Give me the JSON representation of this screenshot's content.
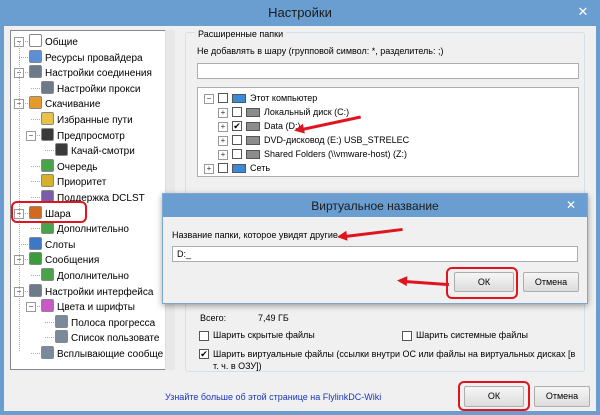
{
  "window": {
    "title": "Настройки",
    "close_glyph": "✕"
  },
  "tree": {
    "items": [
      {
        "label": "Общие",
        "icon": "page-icon",
        "color": "#ffffff",
        "depth": 0
      },
      {
        "label": "Ресурсы провайдера",
        "icon": "users-icon",
        "color": "#5b8fd6",
        "depth": 0
      },
      {
        "label": "Настройки соединения",
        "icon": "network-icon",
        "color": "#6c7a89",
        "depth": 0
      },
      {
        "label": "Настройки прокси",
        "icon": "network-icon",
        "color": "#6c7a89",
        "depth": 1
      },
      {
        "label": "Скачивание",
        "icon": "download-icon",
        "color": "#e39b2b",
        "depth": 0
      },
      {
        "label": "Избранные пути",
        "icon": "folder-icon",
        "color": "#e7c14a",
        "depth": 1
      },
      {
        "label": "Предпросмотр",
        "icon": "film-icon",
        "color": "#3a3a3a",
        "depth": 1
      },
      {
        "label": "Качай-смотри",
        "icon": "film-icon",
        "color": "#3a3a3a",
        "depth": 2
      },
      {
        "label": "Очередь",
        "icon": "queue-icon",
        "color": "#4aa34a",
        "depth": 1
      },
      {
        "label": "Приоритет",
        "icon": "priority-icon",
        "color": "#d6b02b",
        "depth": 1
      },
      {
        "label": "Поддержка DCLST",
        "icon": "dclst-icon",
        "color": "#7a5ca8",
        "depth": 1
      },
      {
        "label": "Шара",
        "icon": "share-icon",
        "color": "#d2691e",
        "depth": 0
      },
      {
        "label": "Дополнительно",
        "icon": "page-icon",
        "color": "#4aa34a",
        "depth": 1
      },
      {
        "label": "Слоты",
        "icon": "slots-icon",
        "color": "#3c78c8",
        "depth": 0
      },
      {
        "label": "Сообщения",
        "icon": "messages-icon",
        "color": "#3c9c3c",
        "depth": 0
      },
      {
        "label": "Дополнительно",
        "icon": "page-icon",
        "color": "#4aa34a",
        "depth": 1
      },
      {
        "label": "Настройки интерфейса",
        "icon": "monitor-icon",
        "color": "#6c7a89",
        "depth": 0
      },
      {
        "label": "Цвета и шрифты",
        "icon": "palette-icon",
        "color": "#c85ac8",
        "depth": 1
      },
      {
        "label": "Полоса прогресса",
        "icon": "progress-icon",
        "color": "#7a8a9a",
        "depth": 2
      },
      {
        "label": "Список пользовате",
        "icon": "list-icon",
        "color": "#7a8a9a",
        "depth": 2
      },
      {
        "label": "Всплывающие сообще",
        "icon": "popup-icon",
        "color": "#7a8a9a",
        "depth": 1
      }
    ]
  },
  "shared": {
    "group_title": "Расширенные папки",
    "hint": "Не добавлять в шару (групповой символ: *, разделитель: ;)",
    "mask_value": "",
    "folders": [
      {
        "label": "Этот компьютер",
        "checked": false,
        "icon": "computer-icon",
        "level": 0,
        "expander": "−"
      },
      {
        "label": "Локальный диск (C:)",
        "checked": false,
        "icon": "drive-icon",
        "level": 1,
        "expander": "+"
      },
      {
        "label": "Data (D:)",
        "checked": true,
        "icon": "drive-icon",
        "level": 1,
        "expander": "+"
      },
      {
        "label": "DVD-дисковод (E:) USB_STRELEC",
        "checked": false,
        "icon": "dvd-drive-icon",
        "level": 1,
        "expander": "+"
      },
      {
        "label": "Shared Folders (\\\\vmware-host) (Z:)",
        "checked": false,
        "icon": "network-drive-icon",
        "level": 1,
        "expander": "+"
      },
      {
        "label": "Сеть",
        "checked": false,
        "icon": "network-icon",
        "level": 0,
        "expander": "+"
      }
    ],
    "total_label": "Всего:",
    "total_value": "7,49 ГБ",
    "options": [
      {
        "label": "Шарить скрытые файлы",
        "checked": false
      },
      {
        "label": "Шарить системные файлы",
        "checked": false
      },
      {
        "label": "Шарить виртуальные файлы (ссылки внутри ОС или файлы на виртуальных дисках [в т. ч. в ОЗУ])",
        "checked": true
      }
    ]
  },
  "dialog": {
    "title": "Виртуальное название",
    "close_glyph": "✕",
    "label": "Название папки, которое увидят другие",
    "value": "D:_",
    "ok": "ОК",
    "cancel": "Отмена"
  },
  "footer": {
    "wiki_link": "Узнайте больше об этой странице на FlylinkDC-Wiki",
    "ok": "ОК",
    "cancel": "Отмена"
  },
  "colors": {
    "titlebar": "#6a9ed1",
    "annotation": "#e0141e",
    "link": "#1a36c4"
  }
}
